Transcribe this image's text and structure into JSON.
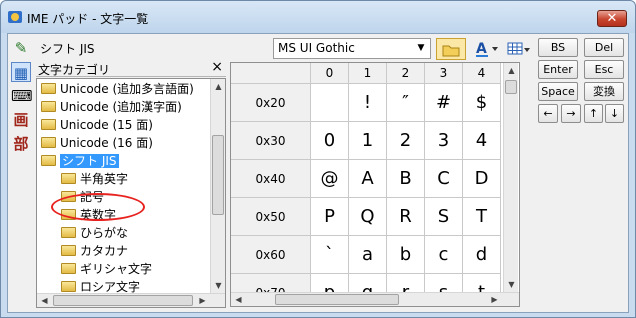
{
  "window": {
    "title": "IME パッド - 文字一覧",
    "close_symbol": "✕"
  },
  "toolbar": {
    "charset_label": "シフト JIS",
    "font_value": "MS UI Gothic",
    "tools": [
      "pen-icon",
      "character-list-icon",
      "keyboard-icon",
      "stroke-count-icon",
      "radical-icon"
    ],
    "tool_glyphs": [
      "✎",
      "▦",
      "⌨",
      "画",
      "部"
    ]
  },
  "tree": {
    "header": "文字カテゴリ",
    "close": "×",
    "items": [
      {
        "label": "Unicode (追加多言語面)",
        "level": 0
      },
      {
        "label": "Unicode (追加漢字面)",
        "level": 0
      },
      {
        "label": "Unicode (15 面)",
        "level": 0
      },
      {
        "label": "Unicode (16 面)",
        "level": 0
      },
      {
        "label": "シフト JIS",
        "level": 0,
        "selected": true
      },
      {
        "label": "半角英字",
        "level": 1
      },
      {
        "label": "記号",
        "level": 1
      },
      {
        "label": "英数字",
        "level": 1
      },
      {
        "label": "ひらがな",
        "level": 1
      },
      {
        "label": "カタカナ",
        "level": 1
      },
      {
        "label": "ギリシャ文字",
        "level": 1
      },
      {
        "label": "ロシア文字",
        "level": 1
      }
    ]
  },
  "grid": {
    "columns": [
      "0",
      "1",
      "2",
      "3",
      "4"
    ],
    "rows": [
      {
        "label": "0x20",
        "chars": [
          "",
          "!",
          "″",
          "#",
          "$"
        ]
      },
      {
        "label": "0x30",
        "chars": [
          "0",
          "1",
          "2",
          "3",
          "4"
        ]
      },
      {
        "label": "0x40",
        "chars": [
          "@",
          "A",
          "B",
          "C",
          "D"
        ]
      },
      {
        "label": "0x50",
        "chars": [
          "P",
          "Q",
          "R",
          "S",
          "T"
        ]
      },
      {
        "label": "0x60",
        "chars": [
          "`",
          "a",
          "b",
          "c",
          "d"
        ]
      },
      {
        "label": "0x70",
        "chars": [
          "p",
          "q",
          "r",
          "s",
          "t"
        ]
      }
    ]
  },
  "keypad": {
    "bs": "BS",
    "del": "Del",
    "enter": "Enter",
    "esc": "Esc",
    "space": "Space",
    "convert": "変換",
    "left": "←",
    "right": "→",
    "up": "↑",
    "down": "↓"
  }
}
